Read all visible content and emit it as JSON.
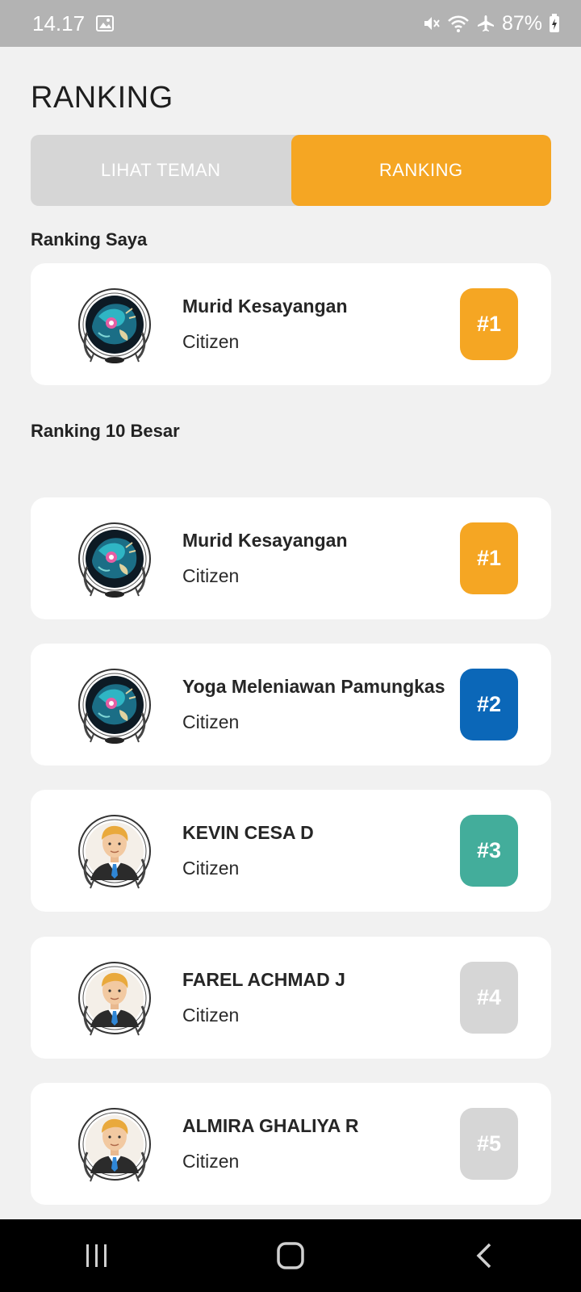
{
  "status_bar": {
    "time": "14.17",
    "battery": "87%",
    "icons": [
      "image-icon",
      "mute-icon",
      "wifi-icon",
      "airplane-icon",
      "battery-charging-icon"
    ]
  },
  "header": {
    "title": "RANKING"
  },
  "tabs": [
    {
      "label": "LIHAT TEMAN",
      "active": false
    },
    {
      "label": "RANKING",
      "active": true
    }
  ],
  "my_ranking": {
    "label": "Ranking Saya",
    "entry": {
      "name": "Murid Kesayangan",
      "role": "Citizen",
      "rank": "#1",
      "avatar": "dragon",
      "badge_color": "#f5a623"
    }
  },
  "top10": {
    "label": "Ranking 10 Besar",
    "entries": [
      {
        "name": "Murid Kesayangan",
        "role": "Citizen",
        "rank": "#1",
        "avatar": "dragon",
        "badge_color": "#f5a623"
      },
      {
        "name": "Yoga Meleniawan Pamungkas",
        "role": "Citizen",
        "rank": "#2",
        "avatar": "dragon",
        "badge_color": "#0b67b8"
      },
      {
        "name": "KEVIN CESA D",
        "role": "Citizen",
        "rank": "#3",
        "avatar": "man",
        "badge_color": "#43ad9b"
      },
      {
        "name": "FAREL ACHMAD J",
        "role": "Citizen",
        "rank": "#4",
        "avatar": "man",
        "badge_color": "#d6d6d6"
      },
      {
        "name": "ALMIRA GHALIYA R",
        "role": "Citizen",
        "rank": "#5",
        "avatar": "man",
        "badge_color": "#d6d6d6"
      }
    ]
  },
  "colors": {
    "accent": "#f5a623",
    "tab_inactive": "#d6d6d6",
    "background": "#f1f1f1"
  }
}
